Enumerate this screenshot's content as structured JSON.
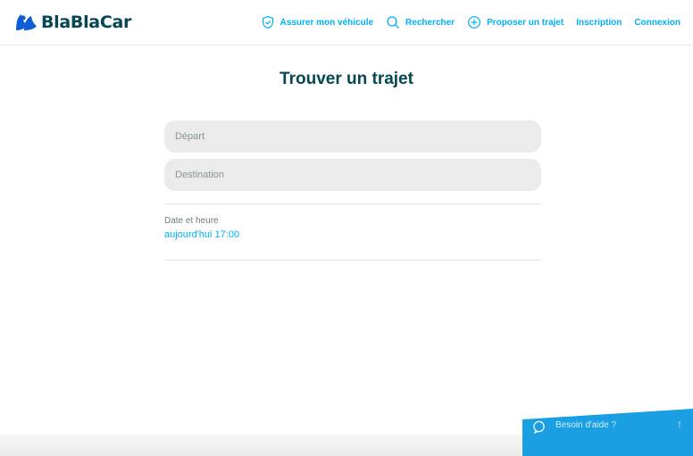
{
  "header": {
    "logo_text": "BlaBlaCar",
    "nav": [
      {
        "label": "Assurer mon véhicule",
        "icon": "shield-check-icon"
      },
      {
        "label": "Rechercher",
        "icon": "search-icon"
      },
      {
        "label": "Proposer un trajet",
        "icon": "plus-circle-icon"
      },
      {
        "label": "Inscription"
      },
      {
        "label": "Connexion"
      }
    ]
  },
  "main": {
    "title": "Trouver un trajet",
    "departure": {
      "placeholder": "Départ",
      "value": ""
    },
    "destination": {
      "placeholder": "Destination",
      "value": ""
    },
    "date": {
      "label": "Date et heure",
      "value": "aujourd'hui 17:00"
    }
  },
  "help": {
    "label": "Besoin d'aide ?",
    "icon": "chat-bubble-icon",
    "arrow_icon": "arrow-up-icon",
    "arrow_glyph": "↑"
  },
  "colors": {
    "brand_dark": "#054752",
    "accent": "#00aff5",
    "field_bg": "#ebebeb",
    "help_bg": "#1a9fe3"
  }
}
